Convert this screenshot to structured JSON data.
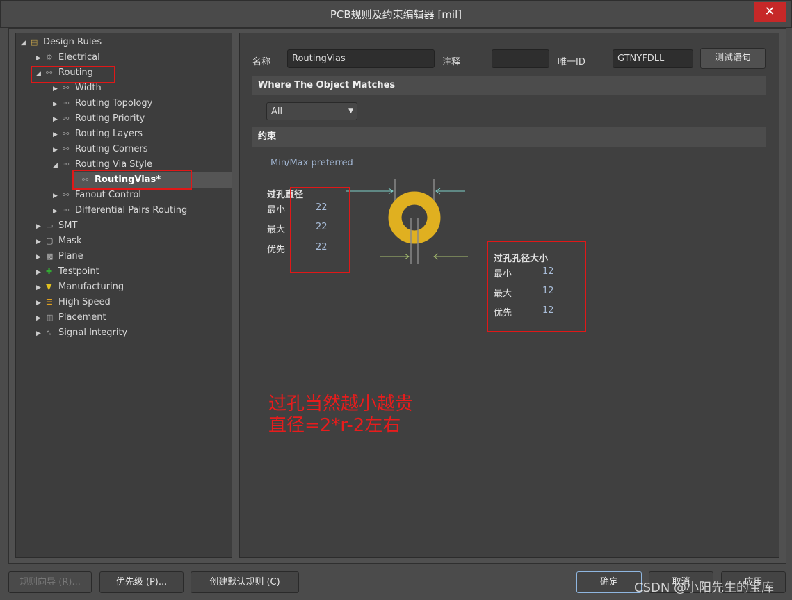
{
  "window": {
    "title": "PCB规则及约束编辑器 [mil]",
    "close_icon": "close-icon"
  },
  "tree": {
    "root": "Design Rules",
    "items": [
      {
        "label": "Electrical",
        "level": 1,
        "expanded": false,
        "icon": "electrical-icon"
      },
      {
        "label": "Routing",
        "level": 1,
        "expanded": true,
        "icon": "routing-icon"
      },
      {
        "label": "Width",
        "level": 2,
        "expanded": false,
        "icon": "routing-icon"
      },
      {
        "label": "Routing Topology",
        "level": 2,
        "expanded": false,
        "icon": "routing-icon"
      },
      {
        "label": "Routing Priority",
        "level": 2,
        "expanded": false,
        "icon": "routing-icon"
      },
      {
        "label": "Routing Layers",
        "level": 2,
        "expanded": false,
        "icon": "routing-icon"
      },
      {
        "label": "Routing Corners",
        "level": 2,
        "expanded": false,
        "icon": "routing-icon"
      },
      {
        "label": "Routing Via Style",
        "level": 2,
        "expanded": true,
        "icon": "routing-icon"
      },
      {
        "label": "RoutingVias*",
        "level": 3,
        "selected": true,
        "icon": "routing-icon"
      },
      {
        "label": "Fanout Control",
        "level": 2,
        "expanded": false,
        "icon": "routing-icon"
      },
      {
        "label": "Differential Pairs Routing",
        "level": 2,
        "expanded": false,
        "icon": "routing-icon"
      },
      {
        "label": "SMT",
        "level": 1,
        "expanded": false,
        "icon": "smt-icon"
      },
      {
        "label": "Mask",
        "level": 1,
        "expanded": false,
        "icon": "mask-icon"
      },
      {
        "label": "Plane",
        "level": 1,
        "expanded": false,
        "icon": "plane-icon"
      },
      {
        "label": "Testpoint",
        "level": 1,
        "expanded": false,
        "icon": "testpoint-icon"
      },
      {
        "label": "Manufacturing",
        "level": 1,
        "expanded": false,
        "icon": "manufacturing-icon"
      },
      {
        "label": "High Speed",
        "level": 1,
        "expanded": false,
        "icon": "high-speed-icon"
      },
      {
        "label": "Placement",
        "level": 1,
        "expanded": false,
        "icon": "placement-icon"
      },
      {
        "label": "Signal Integrity",
        "level": 1,
        "expanded": false,
        "icon": "signal-integrity-icon"
      }
    ]
  },
  "rule": {
    "name_label": "名称",
    "name_value": "RoutingVias",
    "comment_label": "注释",
    "comment_value": "",
    "id_label": "唯一ID",
    "id_value": "GTNYFDLL",
    "test_button": "测试语句"
  },
  "match": {
    "header": "Where The Object Matches",
    "selected": "All"
  },
  "constraints": {
    "header": "约束",
    "mode": "Min/Max preferred",
    "diameter": {
      "title": "过孔直径",
      "min_label": "最小",
      "min": "22",
      "max_label": "最大",
      "max": "22",
      "pref_label": "优先",
      "pref": "22"
    },
    "hole": {
      "title": "过孔孔径大小",
      "min_label": "最小",
      "min": "12",
      "max_label": "最大",
      "max": "12",
      "pref_label": "优先",
      "pref": "12"
    },
    "via_color": "#e0b020"
  },
  "annotation": {
    "line1": "过孔当然越小越贵",
    "line2": "直径=2*r-2左右",
    "color": "#e81c1c"
  },
  "buttons": {
    "wizard": "规则向导 (R)...",
    "priority": "优先级 (P)...",
    "create_default": "创建默认规则 (C)",
    "ok": "确定",
    "cancel": "取消",
    "apply": "应用"
  },
  "watermark": "CSDN @小阳先生的宝库"
}
